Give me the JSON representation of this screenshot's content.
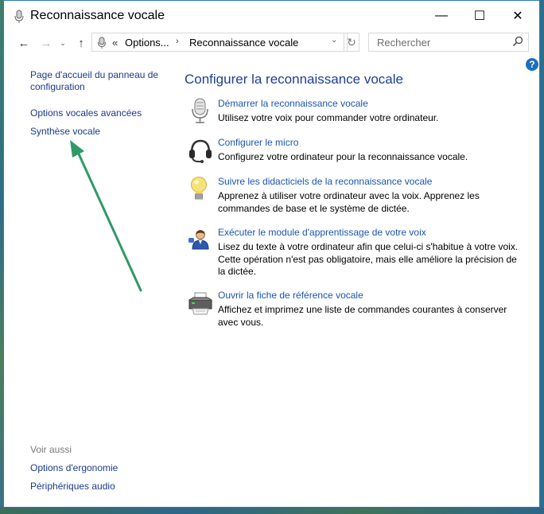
{
  "window": {
    "title": "Reconnaissance vocale",
    "controls": {
      "minimize": "—",
      "maximize": "☐",
      "close": "✕"
    }
  },
  "nav": {
    "back": "←",
    "forward": "→",
    "recent": "⌄",
    "up": "↑",
    "breadcrumb": {
      "overflow": "«",
      "parent": "Options...",
      "separator": "›",
      "current": "Reconnaissance vocale"
    },
    "refresh": "↻",
    "search_placeholder": "Rechercher"
  },
  "help": "?",
  "sidebar": {
    "home": "Page d'accueil du panneau de configuration",
    "advanced": "Options vocales avancées",
    "synthesis": "Synthèse vocale",
    "see_also": "Voir aussi",
    "ergonomics": "Options d'ergonomie",
    "audio_devices": "Périphériques audio"
  },
  "main": {
    "heading": "Configurer la reconnaissance vocale",
    "tasks": [
      {
        "icon": "microphone-icon",
        "link": "Démarrer la reconnaissance vocale",
        "description": "Utilisez votre voix pour commander votre ordinateur."
      },
      {
        "icon": "headset-icon",
        "link": "Configurer le micro",
        "description": "Configurez votre ordinateur pour la reconnaissance vocale."
      },
      {
        "icon": "lightbulb-icon",
        "link": "Suivre les didacticiels de la reconnaissance vocale",
        "description": "Apprenez à utiliser votre ordinateur avec la voix. Apprenez les commandes de base et le système de dictée."
      },
      {
        "icon": "user-speech-icon",
        "link": "Exécuter le module d'apprentissage de votre voix",
        "description": "Lisez du texte à votre ordinateur afin que celui-ci s'habitue à votre voix. Cette opération n'est pas obligatoire, mais elle améliore la précision de la dictée."
      },
      {
        "icon": "printer-icon",
        "link": "Ouvrir la fiche de référence vocale",
        "description": "Affichez et imprimez une liste de commandes courantes à conserver avec vous."
      }
    ]
  },
  "colors": {
    "link": "#1a55b0",
    "heading": "#1c3f96",
    "annotation_arrow": "#2e9a66",
    "window_border": "#2b78c5"
  }
}
